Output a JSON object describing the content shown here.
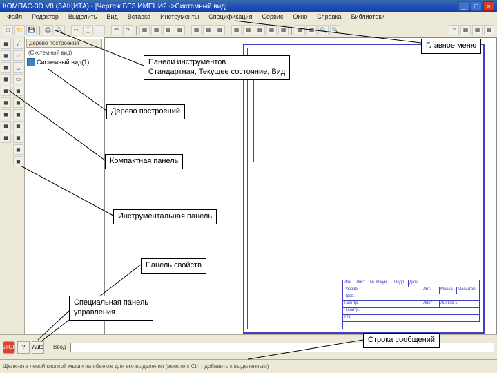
{
  "window": {
    "title": "КОМПАС-3D V8 (ЗАЩИТА) - [Чертеж БЕЗ ИМЕНИ2 ->Системный вид]",
    "min": "_",
    "max": "□",
    "close": "×"
  },
  "menubar": {
    "items": [
      "Файл",
      "Редактор",
      "Выделить",
      "Вид",
      "Вставка",
      "Инструменты",
      "Спецификация",
      "Сервис",
      "Окно",
      "Справка",
      "Библиотеки"
    ]
  },
  "tree": {
    "header": "Дерево построения",
    "header2": "(Системный вид)",
    "item": "Системный вид(1)"
  },
  "callouts": {
    "main_menu": "Главное меню",
    "toolbars": "Панели инструментов\nСтандартная, Текущее состояние, Вид",
    "build_tree": "Дерево построений",
    "compact": "Компактная панель",
    "tools": "Инструментальная панель",
    "props": "Панель свойств",
    "special": "Специальная панель\nуправления",
    "message": "Строка сообщений"
  },
  "titleblock": {
    "r1": [
      "Изм",
      "Лист",
      "№ докум.",
      "Подп.",
      "Дата"
    ],
    "r2": [
      "Разраб."
    ],
    "r3": [
      "Пров."
    ],
    "r4": [
      "Т.контр."
    ],
    "r5": [
      "Н.контр."
    ],
    "r6": [
      "Утв."
    ],
    "c1": [
      "Лит.",
      "Масса",
      "Масштаб"
    ],
    "c2": [
      "Лист",
      "Листов 1"
    ]
  },
  "status": {
    "text": "Щелкните левой кнопкой мыши на объекте для его выделения (вместе с Ctrl - добавить к выделенным)"
  },
  "prop": {
    "stop": "STOP",
    "q": "?",
    "auto": "Auto",
    "text": "Ввод"
  }
}
